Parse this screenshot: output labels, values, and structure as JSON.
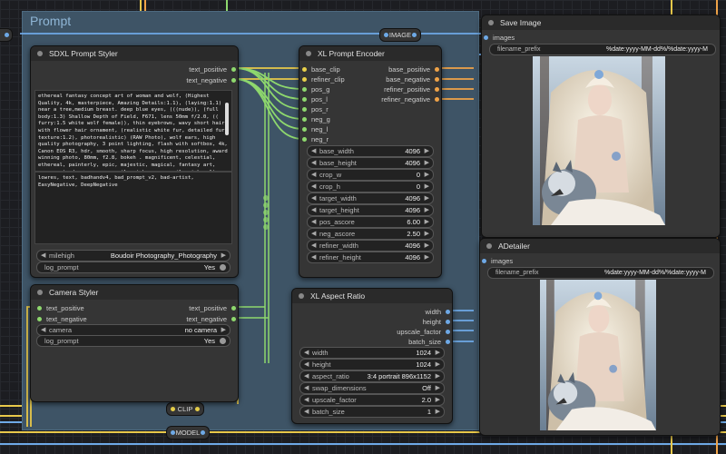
{
  "group": {
    "title": "Prompt"
  },
  "reroutes": {
    "image": "IMAGE",
    "clip": "CLIP",
    "model": "MODEL"
  },
  "sdxl_styler": {
    "title": "SDXL Prompt Styler",
    "outputs": [
      "text_positive",
      "text_negative"
    ],
    "positive_text": "ethereal fantasy concept art of woman and wolf, (Highest Quality, 4k, masterpiece, Amazing Details:1.1), (laying:1.1) near a tree,medium breast. deep blue eyes, (((nude)), (full body:1.3) Shallow Depth of Field, F671, lens 50mm f/2.0, (( furry:1.5 white wolf female)), thin eyebrows, wavy short hair with flower hair ornament, (realistic white fur, detailed fur texture:1.2), photorealistic) (RAW Photo), wolf ears, high quality photography, 3 point lighting, flash with softbox, 4k, Canon EOS R3, hdr, smooth, sharp focus, high resolution, award winning photo, 80mm, f2.8, bokeh . magnificent, celestial, ethereal, painterly, epic, majestic, magical, fantasy art, cover art, dreamy, sexy, evil smirk, sexy, evil smirk, ultra detailed, by Coby Whitmore, - PHOTO",
    "negative_text": "lowres, text, badhandv4, bad_prompt_v2, bad-artist, EasyNegative, DeepNegative",
    "style_label": "milehigh",
    "style_value": "Boudoir Photography_Photography",
    "log_label": "log_prompt",
    "log_value": "Yes"
  },
  "camera_styler": {
    "title": "Camera Styler",
    "inputs": [
      "text_positive",
      "text_negative"
    ],
    "outputs": [
      "text_positive",
      "text_negative"
    ],
    "camera_label": "camera",
    "camera_value": "no camera",
    "log_label": "log_prompt",
    "log_value": "Yes"
  },
  "xl_encoder": {
    "title": "XL Prompt Encoder",
    "inputs": [
      "base_clip",
      "refiner_clip",
      "pos_g",
      "pos_l",
      "pos_r",
      "neg_g",
      "neg_l",
      "neg_r"
    ],
    "outputs": [
      "base_positive",
      "base_negative",
      "refiner_positive",
      "refiner_negative"
    ],
    "widgets": [
      {
        "label": "base_width",
        "value": "4096"
      },
      {
        "label": "base_height",
        "value": "4096"
      },
      {
        "label": "crop_w",
        "value": "0"
      },
      {
        "label": "crop_h",
        "value": "0"
      },
      {
        "label": "target_width",
        "value": "4096"
      },
      {
        "label": "target_height",
        "value": "4096"
      },
      {
        "label": "pos_ascore",
        "value": "6.00"
      },
      {
        "label": "neg_ascore",
        "value": "2.50"
      },
      {
        "label": "refiner_width",
        "value": "4096"
      },
      {
        "label": "refiner_height",
        "value": "4096"
      }
    ]
  },
  "aspect_ratio": {
    "title": "XL Aspect Ratio",
    "outputs": [
      "width",
      "height",
      "upscale_factor",
      "batch_size"
    ],
    "widgets": [
      {
        "label": "width",
        "value": "1024"
      },
      {
        "label": "height",
        "value": "1024"
      },
      {
        "label": "aspect_ratio",
        "value": "3:4 portrait 896x1152"
      },
      {
        "label": "swap_dimensions",
        "value": "Off"
      },
      {
        "label": "upscale_factor",
        "value": "2.0"
      },
      {
        "label": "batch_size",
        "value": "1"
      }
    ]
  },
  "save_image": {
    "title": "Save Image",
    "input": "images",
    "prefix_label": "filename_prefix",
    "prefix_value": "%date:yyyy-MM-dd%/%date:yyyy-M"
  },
  "adetailer": {
    "title": "ADetailer",
    "input": "images",
    "prefix_label": "filename_prefix",
    "prefix_value": "%date:yyyy-MM-dd%/%date:yyyy-M"
  },
  "colors": {
    "group_bg": "#3e5466",
    "node_bg": "#353535",
    "wire_yellow": "#e8c84a",
    "wire_orange": "#f0a348",
    "wire_blue": "#6ea9e6",
    "wire_green": "#8ed86d"
  }
}
